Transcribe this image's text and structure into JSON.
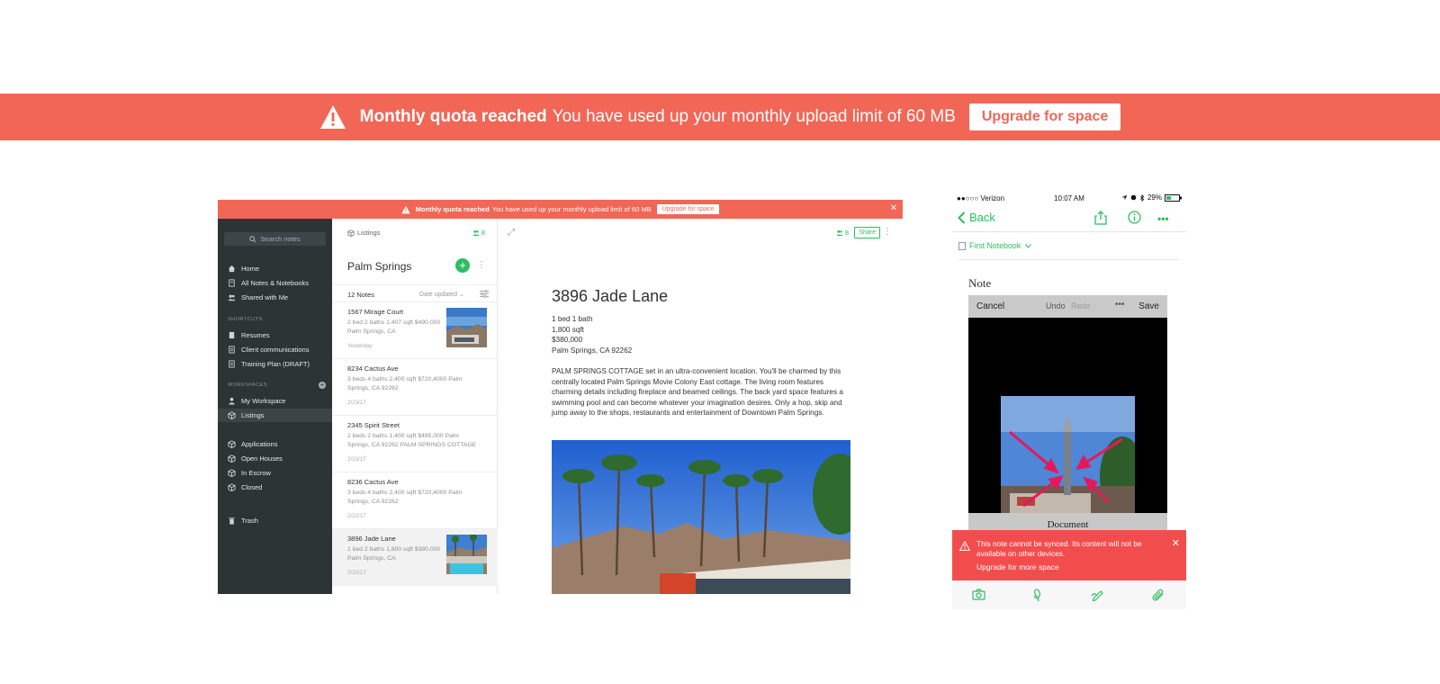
{
  "top_banner": {
    "title": "Monthly quota reached",
    "message": "You have used up your monthly upload limit of 60 MB",
    "button": "Upgrade for space",
    "color": "#f26656"
  },
  "desktop": {
    "banner": {
      "title": "Monthly quota reached",
      "message": "You have used up your monthly upload limit of 60 MB",
      "button": "Upgrade for space",
      "close": "✕"
    },
    "sidebar": {
      "search_placeholder": "Search notes",
      "nav": [
        "Home",
        "All Notes & Notebooks",
        "Shared with Me"
      ],
      "shortcuts_heading": "SHORTCUTS",
      "shortcuts": [
        "Resumes",
        "Client communications",
        "Training Plan (DRAFT)"
      ],
      "workspaces_heading": "WORKSPACES",
      "workspaces": [
        "My Workspace",
        "Listings"
      ],
      "notebooks": [
        "Applications",
        "Open Houses",
        "In Escrow",
        "Closed"
      ],
      "trash": "Trash"
    },
    "notelist": {
      "breadcrumb": "Listings",
      "share_count": "8",
      "notebook_title": "Palm Springs",
      "note_count": "12 Notes",
      "sort": "Date updated",
      "notes": [
        {
          "title": "1567 Mirage Court",
          "snippet": "2 bed 2 baths 1,407 sqft $490,000 Palm Springs, CA",
          "date": "Yesterday"
        },
        {
          "title": "8234 Cactus Ave",
          "snippet": "3 beds 4 baths 2,400 sqft $720,4000 Palm Springs, CA 92262",
          "date": "2/23/17"
        },
        {
          "title": "2345 Spirit Street",
          "snippet": "2 beds 2 baths 1,400 sqft $495,000 Palm Springs, CA 92262 PALM SPRINGS COTTAGE",
          "date": "2/23/17"
        },
        {
          "title": "8236 Cactus Ave",
          "snippet": "3 beds 4 baths 2,400 sqft $720,4000 Palm Springs, CA 92262",
          "date": "2/22/17"
        },
        {
          "title": "3896 Jade Lane",
          "snippet": "1 bed 2 baths 1,800 sqft $380,000 Palm Springs, CA",
          "date": "2/20/17"
        }
      ]
    },
    "editor": {
      "share_count": "8",
      "share_button": "Share",
      "title": "3896 Jade Lane",
      "meta": [
        "1 bed 1 bath",
        "1,800 sqft",
        "$380,000",
        "Palm Springs, CA 92262"
      ],
      "body": "PALM SPRINGS COTTAGE set in an ultra-convenient location. You'll be charmed by this centrally located Palm Springs Movie Colony East cottage. The living room features charming details including fireplace and beamed ceilings. The back yard space features a swimming pool and can become whatever your imagination desires. Only a hop, skip and jump away to the shops, restaurants and entertainment of Downtown Palm Springs."
    }
  },
  "phone": {
    "carrier": "●●○○○ Verizon",
    "time": "10:07 AM",
    "battery": "29%",
    "back": "Back",
    "notebook": "First Notebook",
    "note_title": "Note",
    "markup_toolbar": {
      "cancel": "Cancel",
      "undo": "Undo",
      "redo": "Redo",
      "more": "•••",
      "save": "Save"
    },
    "image_caption": "Document",
    "toast": {
      "message": "This note cannot be synced. Its content will not be available on other devices.",
      "link": "Upgrade for more space",
      "close": "✕",
      "color": "#f24d4d"
    }
  },
  "accent": "#2dbe60"
}
